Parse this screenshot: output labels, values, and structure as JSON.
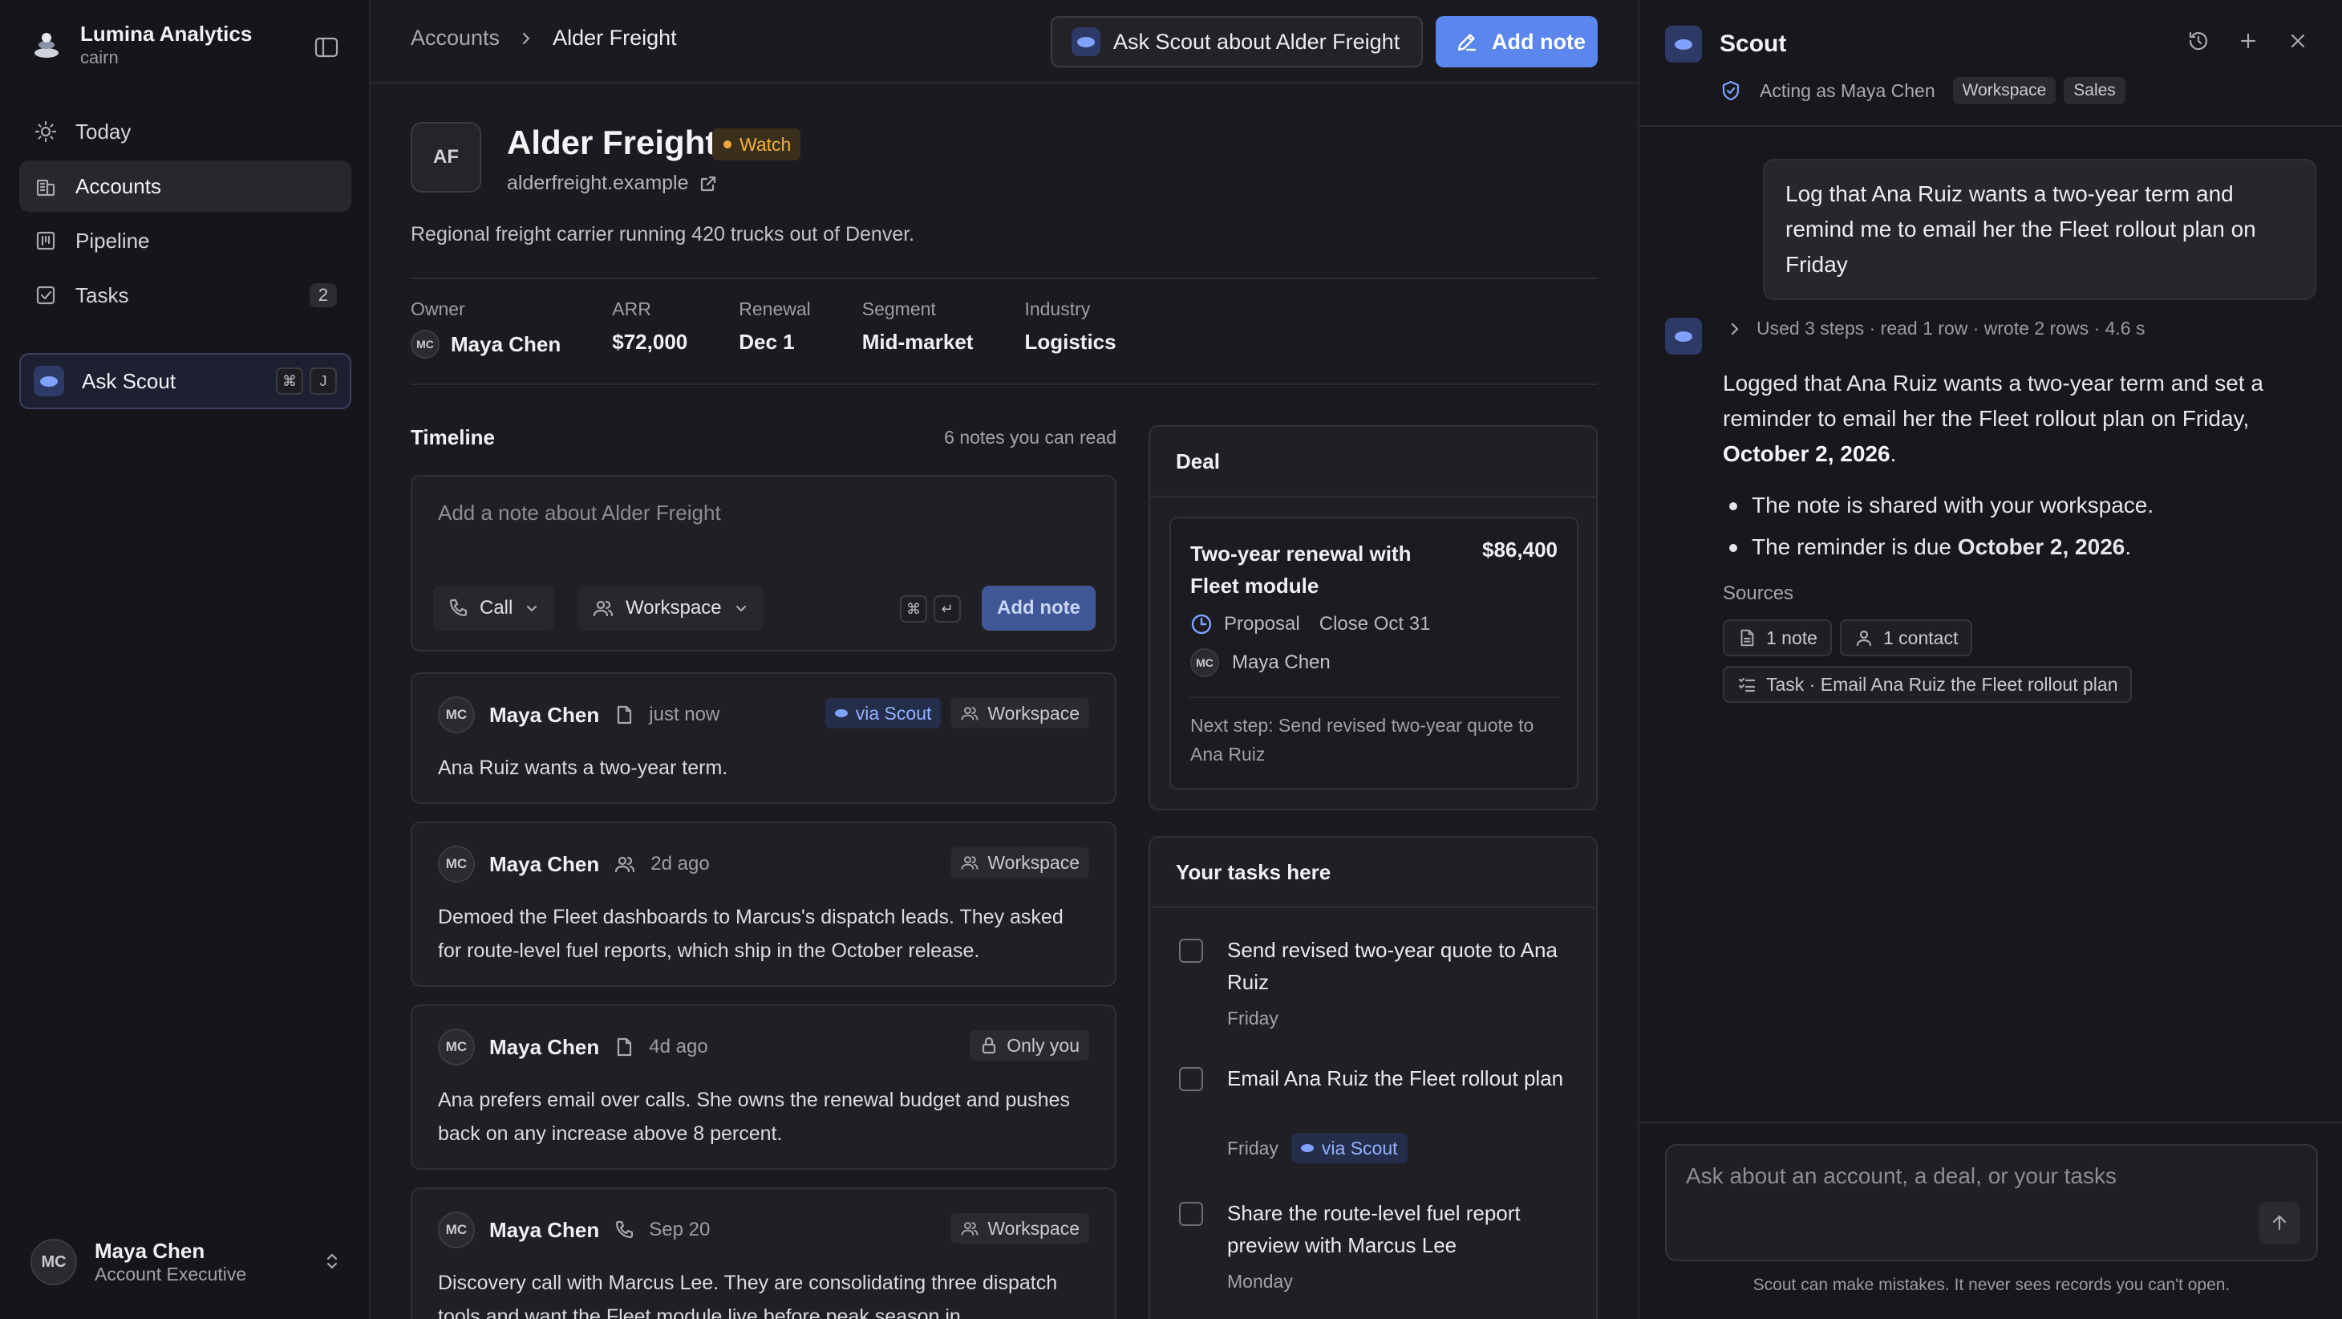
{
  "sidebar": {
    "brand_name": "Lumina Analytics",
    "brand_sub": "cairn",
    "nav": [
      {
        "label": "Today",
        "icon": "sun-icon"
      },
      {
        "label": "Accounts",
        "icon": "building-icon",
        "active": true
      },
      {
        "label": "Pipeline",
        "icon": "pipeline-icon"
      },
      {
        "label": "Tasks",
        "icon": "checkbox-icon",
        "badge": "2"
      }
    ],
    "ask_scout": {
      "label": "Ask Scout",
      "keys": [
        "⌘",
        "J"
      ]
    },
    "user": {
      "initials": "MC",
      "name": "Maya Chen",
      "role": "Account Executive"
    }
  },
  "topbar": {
    "breadcrumb": [
      "Accounts",
      "Alder Freight"
    ],
    "ask_button": "Ask Scout about Alder Freight",
    "add_note_button": "Add note"
  },
  "account": {
    "initials": "AF",
    "name": "Alder Freight",
    "status": "Watch",
    "url": "alderfreight.example",
    "description": "Regional freight carrier running 420 trucks out of Denver.",
    "facts": [
      {
        "label": "Owner",
        "value": "Maya Chen",
        "avatar": "MC"
      },
      {
        "label": "ARR",
        "value": "$72,000"
      },
      {
        "label": "Renewal",
        "value": "Dec 1"
      },
      {
        "label": "Segment",
        "value": "Mid-market"
      },
      {
        "label": "Industry",
        "value": "Logistics"
      }
    ]
  },
  "timeline": {
    "title": "Timeline",
    "count": "6 notes you can read",
    "composer": {
      "placeholder": "Add a note about Alder Freight",
      "type": "Call",
      "visibility": "Workspace",
      "keys": [
        "⌘",
        "↵"
      ],
      "submit": "Add note"
    },
    "notes": [
      {
        "author": "Maya Chen",
        "initials": "MC",
        "kind_icon": "document-icon",
        "time": "just now",
        "via": "via Scout",
        "visibility": "Workspace",
        "visibility_icon": "people-icon",
        "body": "Ana Ruiz wants a two-year term."
      },
      {
        "author": "Maya Chen",
        "initials": "MC",
        "kind_icon": "people-icon",
        "time": "2d ago",
        "visibility": "Workspace",
        "visibility_icon": "people-icon",
        "body": "Demoed the Fleet dashboards to Marcus's dispatch leads. They asked for route-level fuel reports, which ship in the October release."
      },
      {
        "author": "Maya Chen",
        "initials": "MC",
        "kind_icon": "document-icon",
        "time": "4d ago",
        "visibility": "Only you",
        "visibility_icon": "lock-icon",
        "body": "Ana prefers email over calls. She owns the renewal budget and pushes back on any increase above 8 percent."
      },
      {
        "author": "Maya Chen",
        "initials": "MC",
        "kind_icon": "phone-icon",
        "time": "Sep 20",
        "visibility": "Workspace",
        "visibility_icon": "people-icon",
        "body": "Discovery call with Marcus Lee. They are consolidating three dispatch tools and want the Fleet module live before peak season in"
      }
    ]
  },
  "deal": {
    "title": "Deal",
    "name": "Two-year renewal with Fleet module",
    "amount": "$86,400",
    "stage": "Proposal",
    "close": "Close Oct 31",
    "owner": "Maya Chen",
    "owner_initials": "MC",
    "next_step": "Next step: Send revised two-year quote to Ana Ruiz"
  },
  "tasks": {
    "title": "Your tasks here",
    "items": [
      {
        "text": "Send revised two-year quote to Ana Ruiz",
        "due": "Friday"
      },
      {
        "text": "Email Ana Ruiz the Fleet rollout plan",
        "due": "Friday",
        "via": "via Scout"
      },
      {
        "text": "Share the route-level fuel report preview with Marcus Lee",
        "due": "Monday"
      }
    ]
  },
  "scout": {
    "title": "Scout",
    "acting_as": "Acting as Maya Chen",
    "scopes": [
      "Workspace",
      "Sales"
    ],
    "user_message": "Log that Ana Ruiz wants a two-year term and remind me to email her the Fleet rollout plan on Friday",
    "steps_summary": "Used 3 steps · read 1 row · wrote 2 rows · 4.6 s",
    "reply_intro": "Logged that Ana Ruiz wants a two-year term and set a reminder to email her the Fleet rollout plan on Friday,",
    "reply_date": "October 2, 2026",
    "reply_bullets": [
      {
        "text": "The note is shared with your workspace.",
        "bold": ""
      },
      {
        "text": "The reminder is due ",
        "bold": "October 2, 2026"
      }
    ],
    "sources_label": "Sources",
    "sources": [
      "1 note",
      "1 contact",
      "Task · Email Ana Ruiz the Fleet rollout plan"
    ],
    "input_placeholder": "Ask about an account, a deal, or your tasks",
    "disclaimer": "Scout can make mistakes. It never sees records you can't open."
  },
  "colors": {
    "accent": "#5b86ee",
    "watch": "#f3b13b",
    "scout": "#7fa2ff"
  }
}
